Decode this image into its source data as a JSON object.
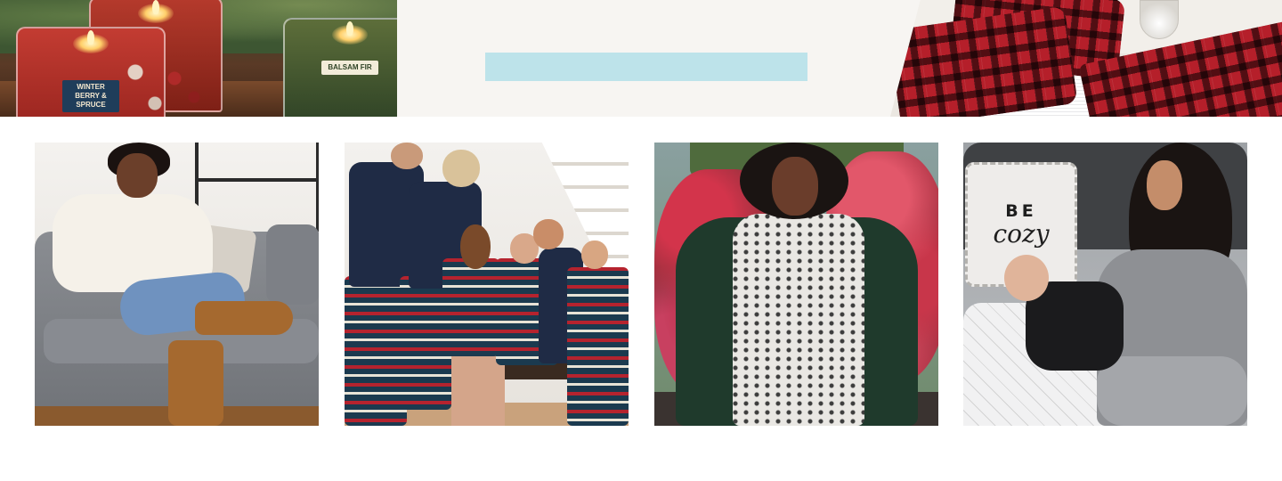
{
  "banner": {
    "candles": [
      {
        "icon": "candle-icon",
        "label": "WINTER BERRY & SPRUCE"
      },
      {
        "icon": "candle-icon",
        "label": ""
      },
      {
        "icon": "candle-icon",
        "label": "BALSAM FIR"
      }
    ],
    "center_bar_color": "#bde3ea",
    "colors": {
      "plaid": "#b51f2a",
      "background": "#f7f5f2"
    }
  },
  "cards": [
    {
      "name": "woman-on-sofa-photo"
    },
    {
      "name": "family-pajamas-photo"
    },
    {
      "name": "woman-red-foliage-photo"
    },
    {
      "name": "mother-baby-photo",
      "pillow_text": {
        "line1": "BE",
        "line2": "cozy"
      }
    }
  ]
}
